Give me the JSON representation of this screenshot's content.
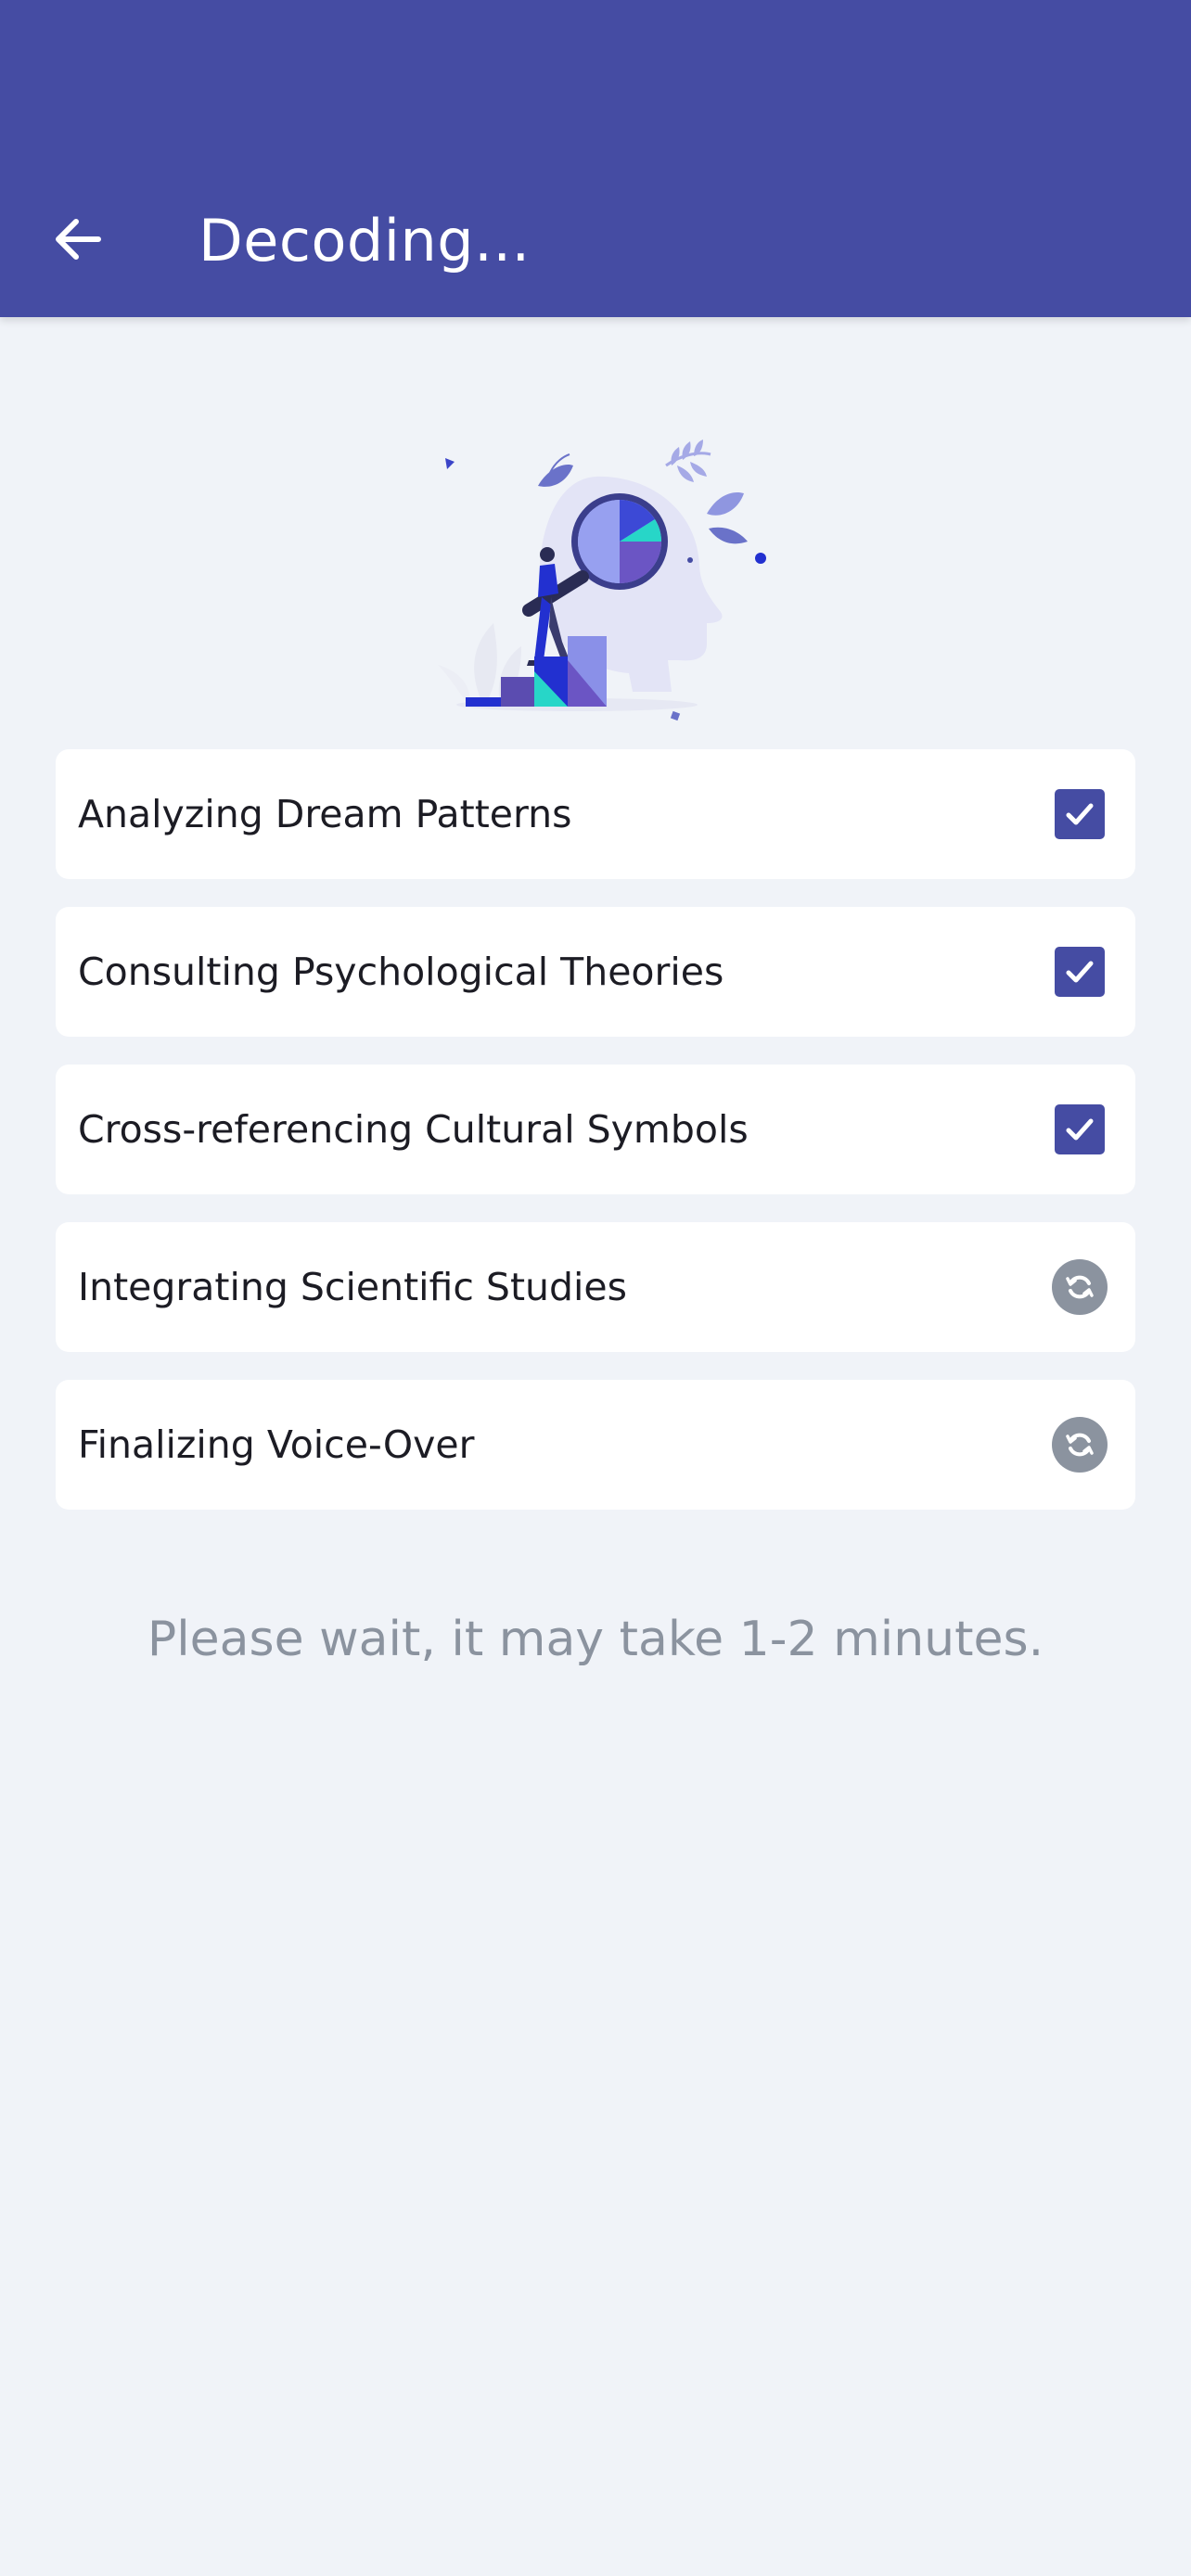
{
  "header": {
    "title": "Decoding..."
  },
  "steps": [
    {
      "label": "Analyzing Dream Patterns",
      "status": "done",
      "icon": "checkbox-checked-icon"
    },
    {
      "label": "Consulting Psychological Theories",
      "status": "done",
      "icon": "checkbox-checked-icon"
    },
    {
      "label": "Cross-referencing Cultural Symbols",
      "status": "done",
      "icon": "checkbox-checked-icon"
    },
    {
      "label": "Integrating Scientific Studies",
      "status": "pending",
      "icon": "sync-icon"
    },
    {
      "label": "Finalizing Voice-Over",
      "status": "pending",
      "icon": "sync-icon"
    }
  ],
  "footer": {
    "wait_message": "Please wait, it may take 1-2 minutes."
  },
  "colors": {
    "primary": "#454ca3",
    "background": "#f0f3f8",
    "muted": "#8b939f",
    "card": "#ffffff"
  }
}
